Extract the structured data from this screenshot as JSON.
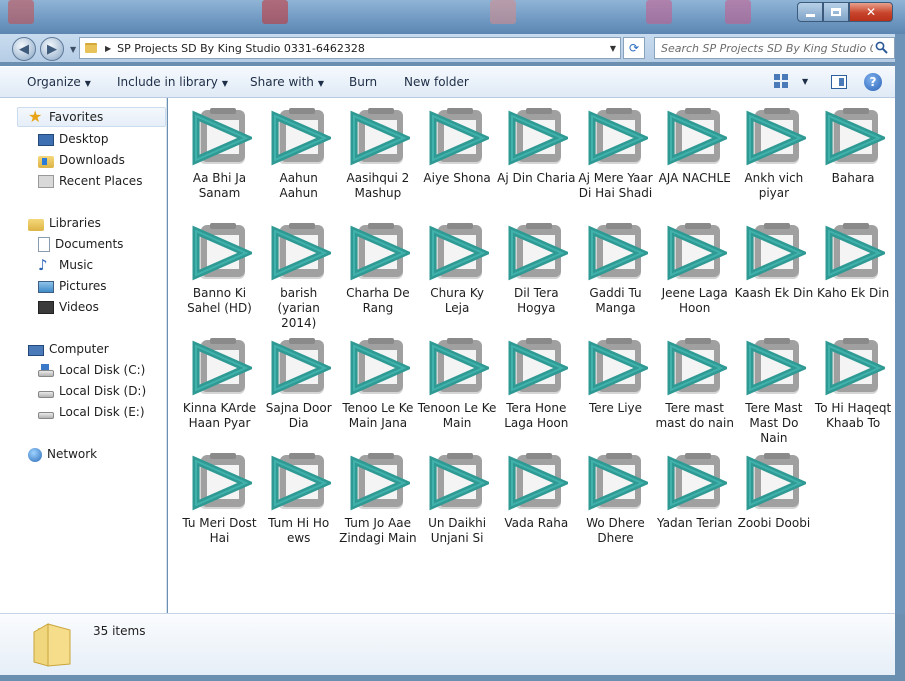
{
  "window": {
    "address_path": "SP Projects SD By King Studio 0331-6462328",
    "search_placeholder": "Search SP Projects SD By King Studio 0..."
  },
  "toolbar": {
    "organize": "Organize",
    "include_in_library": "Include in library",
    "share_with": "Share with",
    "burn": "Burn",
    "new_folder": "New folder"
  },
  "nav": {
    "favorites": "Favorites",
    "desktop": "Desktop",
    "downloads": "Downloads",
    "recent_places": "Recent Places",
    "libraries": "Libraries",
    "documents": "Documents",
    "music": "Music",
    "pictures": "Pictures",
    "videos": "Videos",
    "computer": "Computer",
    "local_c": "Local Disk (C:)",
    "local_d": "Local Disk (D:)",
    "local_e": "Local Disk (E:)",
    "network": "Network"
  },
  "files": [
    "Aa Bhi Ja Sanam",
    "Aahun Aahun",
    "Aasihqui 2 Mashup",
    "Aiye Shona",
    "Aj Din Charia",
    "Aj Mere Yaar Di Hai Shadi",
    "AJA NACHLE",
    "Ankh vich piyar",
    "Bahara",
    "Banno Ki Sahel (HD)",
    "barish (yarian 2014)",
    "Charha De Rang",
    "Chura Ky Leja",
    "Dil Tera Hogya",
    "Gaddi Tu Manga",
    "Jeene Laga Hoon",
    "Kaash Ek Din",
    "Kaho Ek Din",
    "Kinna KArde Haan Pyar",
    "Sajna Door Dia",
    "Tenoo Le Ke Main Jana",
    "Tenoon Le Ke Main",
    "Tera Hone Laga Hoon",
    "Tere Liye",
    "Tere mast mast do nain",
    "Tere Mast Mast Do Nain",
    "To Hi Haqeqt Khaab To",
    "Tu Meri Dost Hai",
    "Tum Hi Ho ews",
    "Tum Jo Aae Zindagi Main",
    "Un Daikhi Unjani Si",
    "Vada Raha",
    "Wo Dhere Dhere",
    "Yadan Terian",
    "Zoobi Doobi"
  ],
  "details": {
    "item_count": "35 items"
  },
  "colors": {
    "icon_teal": "#2f9a94",
    "icon_gray": "#9a9a9a",
    "accent": "#2b62b5"
  }
}
